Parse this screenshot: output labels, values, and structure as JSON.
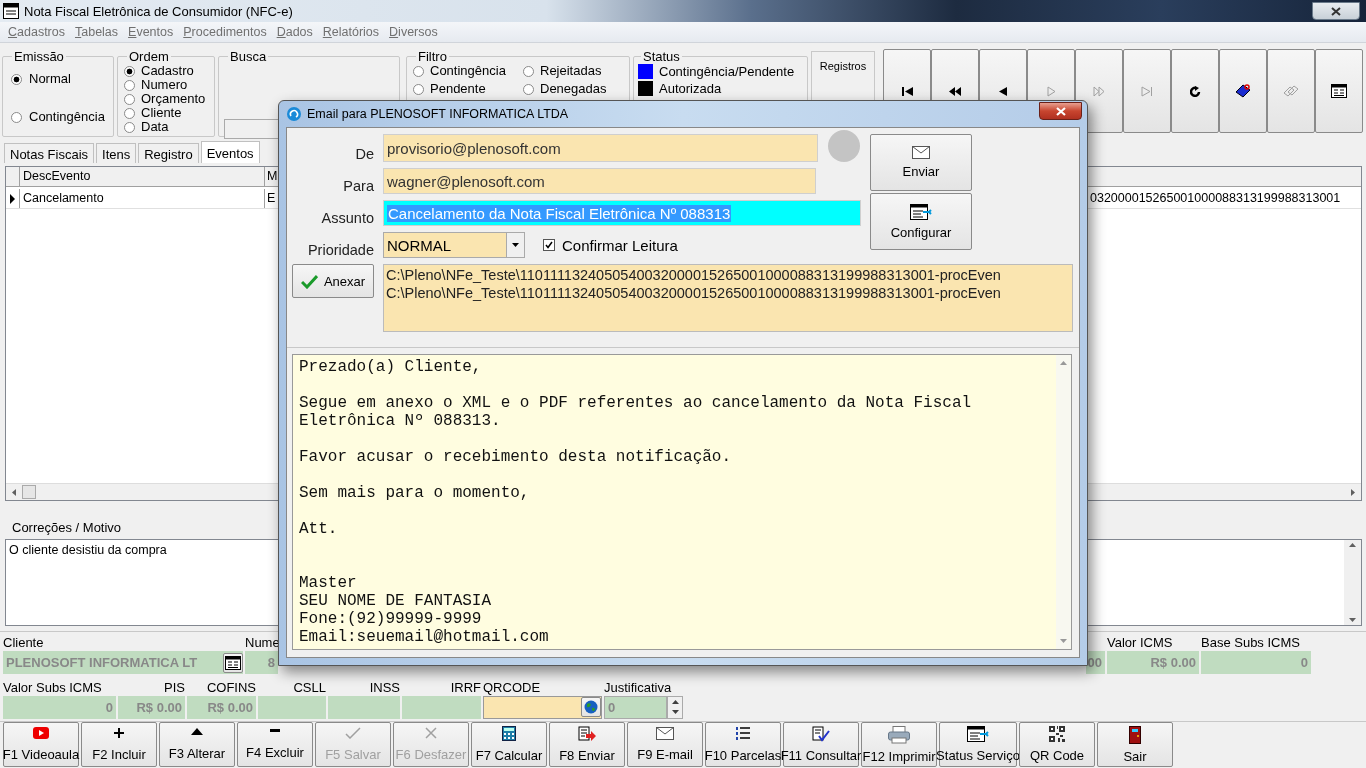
{
  "window": {
    "title": "Nota Fiscal Eletrônica de Consumidor (NFC-e)"
  },
  "menu": [
    "Cadastros",
    "Tabelas",
    "Eventos",
    "Procedimentos",
    "Dados",
    "Relatórios",
    "Diversos"
  ],
  "emissao": {
    "label": "Emissão",
    "options": [
      {
        "label": "Normal",
        "selected": true
      },
      {
        "label": "Contingência",
        "selected": false
      }
    ]
  },
  "ordem": {
    "label": "Ordem",
    "options": [
      {
        "label": "Cadastro",
        "selected": true
      },
      {
        "label": "Numero",
        "selected": false
      },
      {
        "label": "Orçamento",
        "selected": false
      },
      {
        "label": "Cliente",
        "selected": false
      },
      {
        "label": "Data",
        "selected": false
      }
    ]
  },
  "busca": {
    "label": "Busca"
  },
  "filtro": {
    "label": "Filtro",
    "options": [
      {
        "label": "Contingência",
        "selected": false
      },
      {
        "label": "Rejeitadas",
        "selected": false
      },
      {
        "label": "Pendente",
        "selected": false
      },
      {
        "label": "Denegadas",
        "selected": false
      }
    ]
  },
  "status": {
    "label": "Status",
    "items": [
      {
        "label": "Contingência/Pendente",
        "color": "#0000ff"
      },
      {
        "label": "Autorizada",
        "color": "#000000"
      }
    ]
  },
  "registros": {
    "label": "Registros"
  },
  "nav_buttons": [
    {
      "kind": "first",
      "disabled": false
    },
    {
      "kind": "rewind",
      "disabled": false
    },
    {
      "kind": "prev",
      "disabled": false
    },
    {
      "kind": "next",
      "disabled": true
    },
    {
      "kind": "forward",
      "disabled": true
    },
    {
      "kind": "last",
      "disabled": true
    },
    {
      "kind": "refresh",
      "disabled": false
    },
    {
      "kind": "tag",
      "disabled": false
    },
    {
      "kind": "goto",
      "disabled": true
    },
    {
      "kind": "form",
      "disabled": false
    }
  ],
  "tabs": [
    {
      "label": "Notas Fiscais",
      "selected": false
    },
    {
      "label": "Itens",
      "selected": false
    },
    {
      "label": "Registro",
      "selected": false
    },
    {
      "label": "Eventos",
      "selected": true
    }
  ],
  "grid": {
    "columns": [
      "DescEvento",
      "M"
    ],
    "rows": [
      {
        "selected": true,
        "cells": [
          "Cancelamento",
          "E",
          "032000015265001000088313199988313001"
        ]
      }
    ]
  },
  "correcoes": {
    "label": "Correções / Motivo",
    "text": "O cliente desistiu da compra"
  },
  "fields_row1": [
    {
      "label": "Cliente",
      "value": "PLENOSOFT INFORMATICA LT",
      "kind": "lookup"
    },
    {
      "label": "Nume",
      "value": "8",
      "kind": "text"
    },
    {
      "value": "00",
      "kind": "text"
    },
    {
      "label": "Valor ICMS",
      "value": "R$ 0.00",
      "kind": "text"
    },
    {
      "label": "Base Subs ICMS",
      "value": "0",
      "kind": "text"
    }
  ],
  "fields_row2": [
    {
      "label": "Valor Subs ICMS",
      "value": "0",
      "kind": "text"
    },
    {
      "label": "PIS",
      "value": "R$ 0.00",
      "kind": "text"
    },
    {
      "label": "COFINS",
      "value": "R$ 0.00",
      "kind": "text"
    },
    {
      "label": "CSLL",
      "kind": "text"
    },
    {
      "label": "INSS",
      "kind": "text"
    },
    {
      "label": "IRRF",
      "kind": "text"
    },
    {
      "label": "QRCODE",
      "kind": "url"
    },
    {
      "label": "Justificativa",
      "value": "0",
      "kind": "spin"
    }
  ],
  "function_buttons": [
    {
      "label": "F1 Videoaula",
      "kind": "video",
      "disabled": false
    },
    {
      "label": "F2 Incluir",
      "kind": "plus",
      "disabled": false
    },
    {
      "label": "F3 Alterar",
      "kind": "up",
      "disabled": false
    },
    {
      "label": "F4 Excluir",
      "kind": "minus",
      "disabled": false
    },
    {
      "label": "F5 Salvar",
      "kind": "check",
      "disabled": true
    },
    {
      "label": "F6 Desfazer",
      "kind": "cross",
      "disabled": true
    },
    {
      "label": "F7 Calcular",
      "kind": "calc",
      "disabled": false
    },
    {
      "label": "F8 Enviar",
      "kind": "send",
      "disabled": false
    },
    {
      "label": "F9 E-mail",
      "kind": "mail",
      "disabled": false
    },
    {
      "label": "F10 Parcelas",
      "kind": "list",
      "disabled": false
    },
    {
      "label": "F11 Consultar",
      "kind": "consult",
      "disabled": false
    },
    {
      "label": "F12 Imprimir",
      "kind": "print",
      "disabled": false
    },
    {
      "label": "Status Serviço",
      "kind": "status",
      "disabled": false
    },
    {
      "label": "QR Code",
      "kind": "qr",
      "disabled": false
    },
    {
      "label": "Sair",
      "kind": "exit",
      "disabled": false
    }
  ],
  "dialog": {
    "title": "Email para PLENOSOFT INFORMATICA LTDA",
    "fields": [
      {
        "label": "De",
        "value": "provisorio@plenosoft.com",
        "selected": false
      },
      {
        "label": "Para",
        "value": "wagner@plenosoft.com",
        "selected": false
      },
      {
        "label": "Assunto",
        "value": "Cancelamento da Nota Fiscal Eletrônica Nº 088313",
        "selected": true
      }
    ],
    "prioridade": {
      "label": "Prioridade",
      "value": "NORMAL"
    },
    "confirm": {
      "label": "Confirmar Leitura",
      "checked": true
    },
    "buttons": [
      {
        "label": "Enviar",
        "kind": "mail"
      },
      {
        "label": "Configurar",
        "kind": "status"
      }
    ],
    "attach_button": "Anexar",
    "attachments": [
      "C:\\Pleno\\NFe_Teste\\1101111324050540032000015265001000088313199988313001-procEven",
      "C:\\Pleno\\NFe_Teste\\1101111324050540032000015265001000088313199988313001-procEven"
    ],
    "message": "Prezado(a) Cliente,\n\nSegue em anexo o XML e o PDF referentes ao cancelamento da Nota Fiscal Eletrônica Nº 088313.\n\nFavor acusar o recebimento desta notificação.\n\nSem mais para o momento,\n\nAtt.\n\n\nMaster\nSEU NOME DE FANTASIA\nFone:(92)99999-9999\nEmail:seuemail@hotmail.com"
  }
}
